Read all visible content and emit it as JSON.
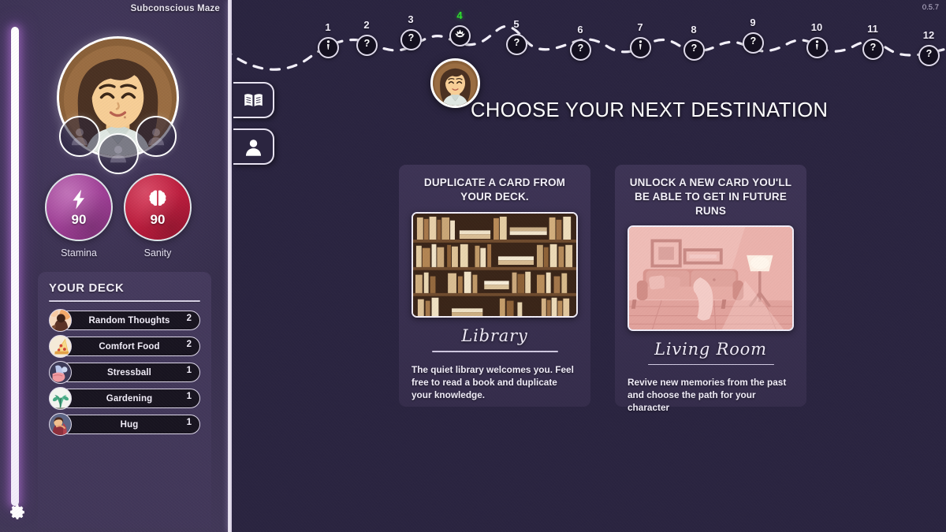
{
  "meta": {
    "zone_label": "Subconscious Maze",
    "version": "0.5.7"
  },
  "sidebar": {
    "portrait_alt": "character-portrait",
    "relic_slots": [
      "empty-relic-slot-1",
      "empty-relic-slot-2",
      "empty-relic-slot-3"
    ],
    "stats": [
      {
        "key": "stamina",
        "label": "Stamina",
        "value": "90",
        "icon": "lightning-bolt-icon",
        "color": "#a8459a"
      },
      {
        "key": "sanity",
        "label": "Sanity",
        "value": "90",
        "icon": "brain-icon",
        "color": "#c2243f"
      }
    ],
    "deck": {
      "title": "YOUR DECK",
      "cards": [
        {
          "name": "Random Thoughts",
          "count": "2",
          "icon": "thinking-person-icon"
        },
        {
          "name": "Comfort Food",
          "count": "2",
          "icon": "pizza-slice-icon"
        },
        {
          "name": "Stressball",
          "count": "1",
          "icon": "stressball-hand-icon"
        },
        {
          "name": "Gardening",
          "count": "1",
          "icon": "plants-icon"
        },
        {
          "name": "Hug",
          "count": "1",
          "icon": "hug-icon"
        }
      ]
    },
    "settings_label": "gear-icon"
  },
  "path": {
    "nodes": [
      {
        "number": "1",
        "icon": "info-icon",
        "current": false
      },
      {
        "number": "2",
        "icon": "question-icon",
        "current": false
      },
      {
        "number": "3",
        "icon": "question-icon",
        "current": false
      },
      {
        "number": "4",
        "icon": "lotus-icon",
        "current": true
      },
      {
        "number": "5",
        "icon": "question-icon",
        "current": false
      },
      {
        "number": "6",
        "icon": "question-icon",
        "current": false
      },
      {
        "number": "7",
        "icon": "info-icon",
        "current": false
      },
      {
        "number": "8",
        "icon": "question-icon",
        "current": false
      },
      {
        "number": "9",
        "icon": "question-icon",
        "current": false
      },
      {
        "number": "10",
        "icon": "info-icon",
        "current": false
      },
      {
        "number": "11",
        "icon": "question-icon",
        "current": false
      },
      {
        "number": "12",
        "icon": "question-icon",
        "current": false
      }
    ]
  },
  "side_buttons": [
    {
      "key": "journal",
      "icon": "open-book-icon"
    },
    {
      "key": "character",
      "icon": "person-icon"
    }
  ],
  "main": {
    "title": "CHOOSE YOUR NEXT DESTINATION",
    "destinations": [
      {
        "headline": "DUPLICATE A CARD FROM YOUR DECK.",
        "name": "Library",
        "description": "The quiet library welcomes you. Feel free to read a book and duplicate your knowledge.",
        "image": "library-bookshelf-image"
      },
      {
        "headline": "UNLOCK A NEW CARD YOU'LL BE ABLE TO GET IN FUTURE RUNS",
        "name": "Living Room",
        "description": "Revive new memories from the past and choose the path for your character",
        "image": "living-room-image"
      }
    ]
  }
}
